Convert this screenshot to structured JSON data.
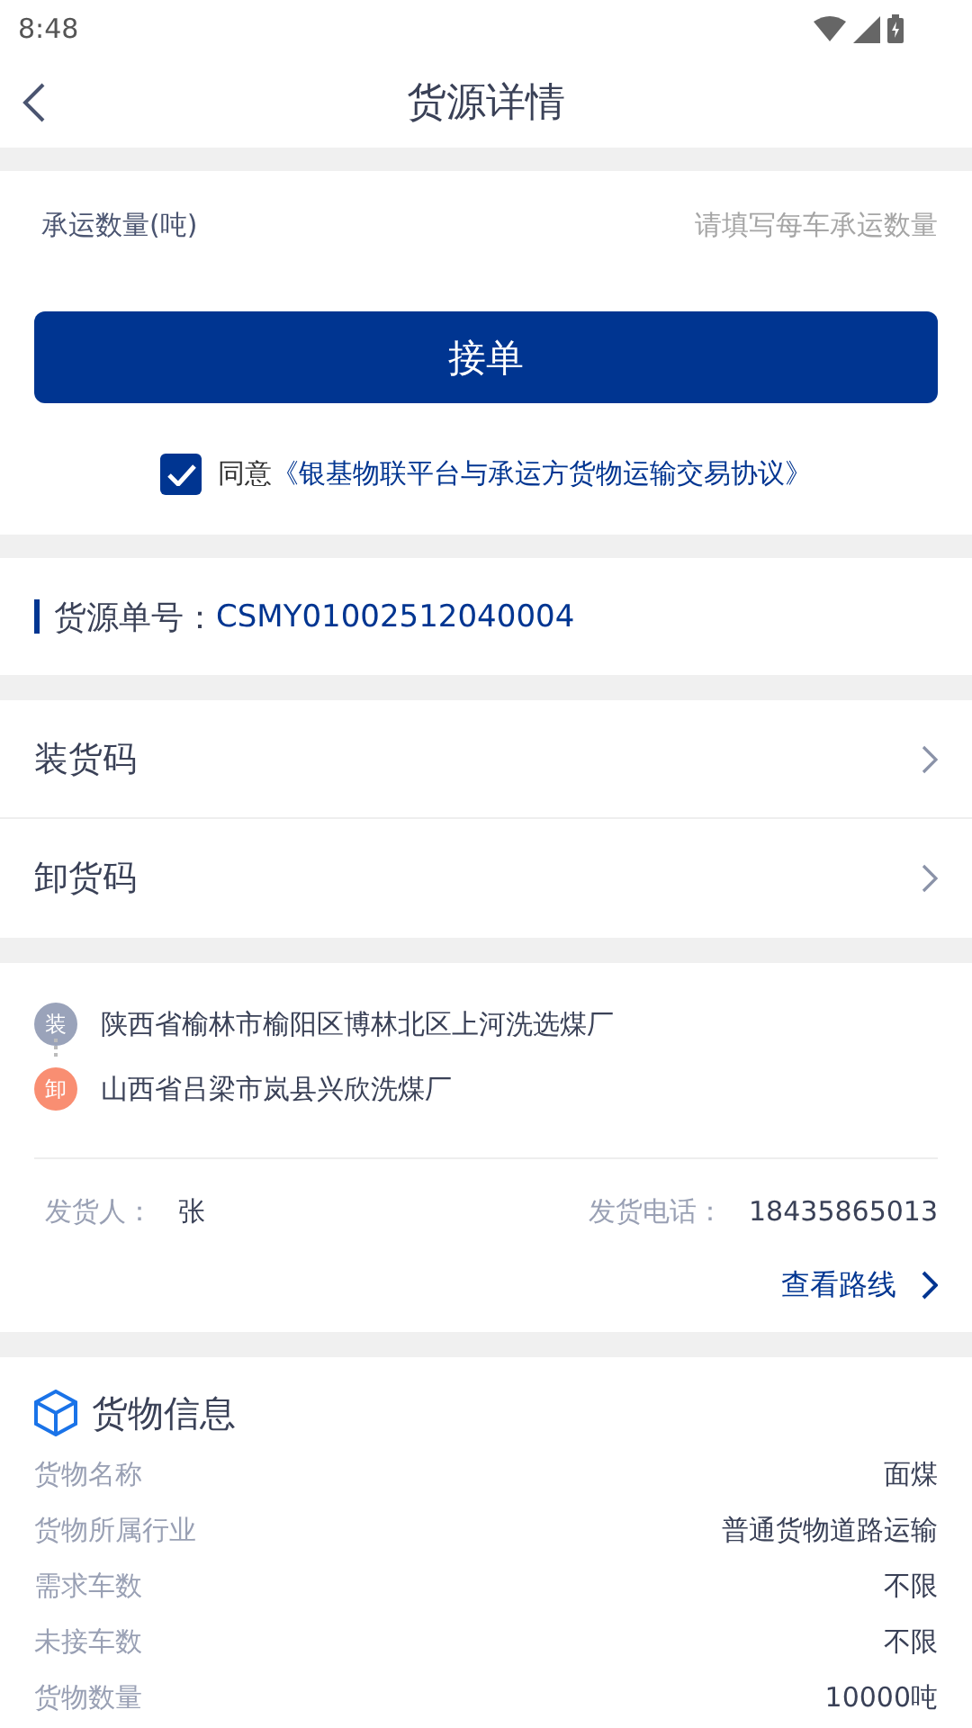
{
  "status_bar": {
    "time": "8:48"
  },
  "header": {
    "title": "货源详情"
  },
  "quantity_field": {
    "label": "承运数量(吨)",
    "placeholder": "请填写每车承运数量"
  },
  "accept_button": "接单",
  "agreement": {
    "checked": true,
    "prefix": "同意",
    "link": "《银基物联平台与承运方货物运输交易协议》"
  },
  "order_number": {
    "label": "货源单号：",
    "value": "CSMY01002512040004"
  },
  "code_rows": [
    {
      "label": "装货码"
    },
    {
      "label": "卸货码"
    }
  ],
  "route": {
    "stops": [
      {
        "badge": "装",
        "address": "陕西省榆林市榆阳区博林北区上河洗选煤厂",
        "color": "#9aa3ba"
      },
      {
        "badge": "卸",
        "address": "山西省吕梁市岚县兴欣洗煤厂",
        "color": "#f98e72"
      }
    ],
    "shipper_label": "发货人：",
    "shipper": "张",
    "phone_label": "发货电话：",
    "phone": "18435865013",
    "view_route": "查看路线"
  },
  "goods": {
    "title": "货物信息",
    "rows": [
      {
        "label": "货物名称",
        "value": "面煤"
      },
      {
        "label": "货物所属行业",
        "value": "普通货物道路运输"
      },
      {
        "label": "需求车数",
        "value": "不限"
      },
      {
        "label": "未接车数",
        "value": "不限"
      },
      {
        "label": "货物数量",
        "value": "10000吨"
      }
    ]
  }
}
